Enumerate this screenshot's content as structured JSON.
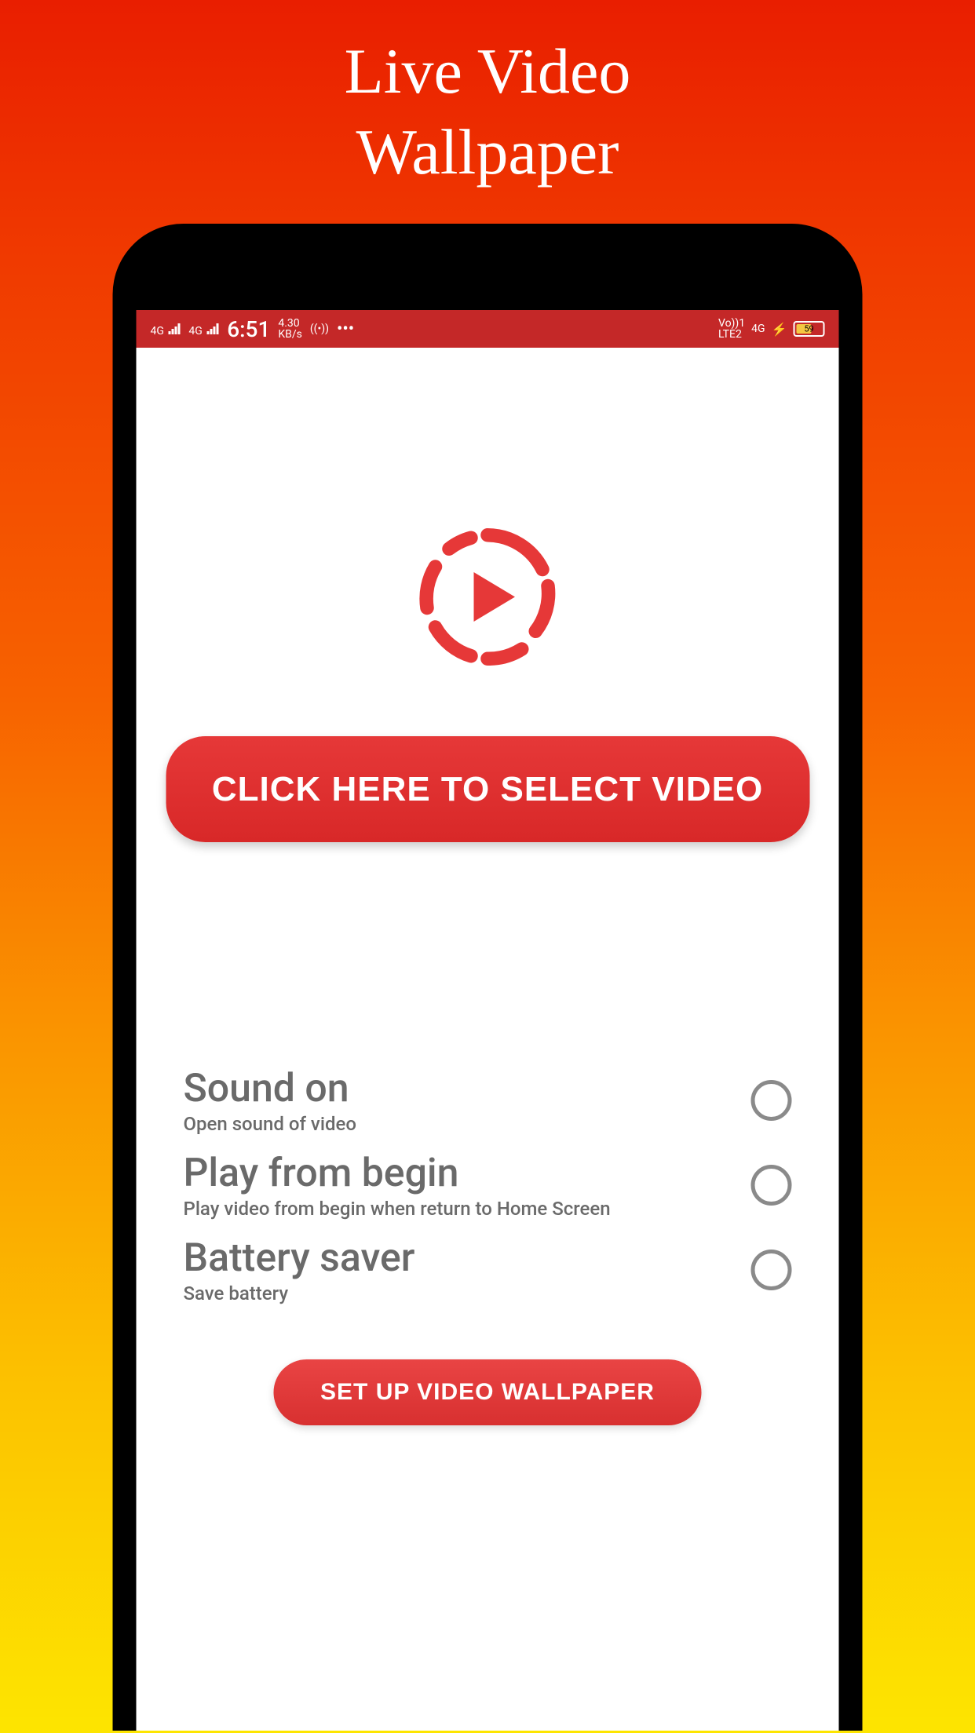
{
  "page": {
    "title_line1": "Live Video",
    "title_line2": "Wallpaper"
  },
  "statusbar": {
    "signal1": "4G",
    "signal2": "4G",
    "time": "6:51",
    "speed": "4.30",
    "speed_unit": "KB/s",
    "dots": "•••",
    "volte": "Vo))1",
    "lte": "LTE2",
    "net": "4G",
    "battery": "59"
  },
  "main": {
    "select_button": "CLICK HERE TO SELECT VIDEO",
    "setup_button": "SET UP VIDEO WALLPAPER"
  },
  "settings": [
    {
      "title": "Sound on",
      "subtitle": "Open sound of video",
      "checked": false
    },
    {
      "title": "Play from begin",
      "subtitle": "Play video from begin when return to Home Screen",
      "checked": false
    },
    {
      "title": "Battery saver",
      "subtitle": "Save battery",
      "checked": false
    }
  ],
  "colors": {
    "accent": "#e63838",
    "statusbar": "#c42828"
  }
}
